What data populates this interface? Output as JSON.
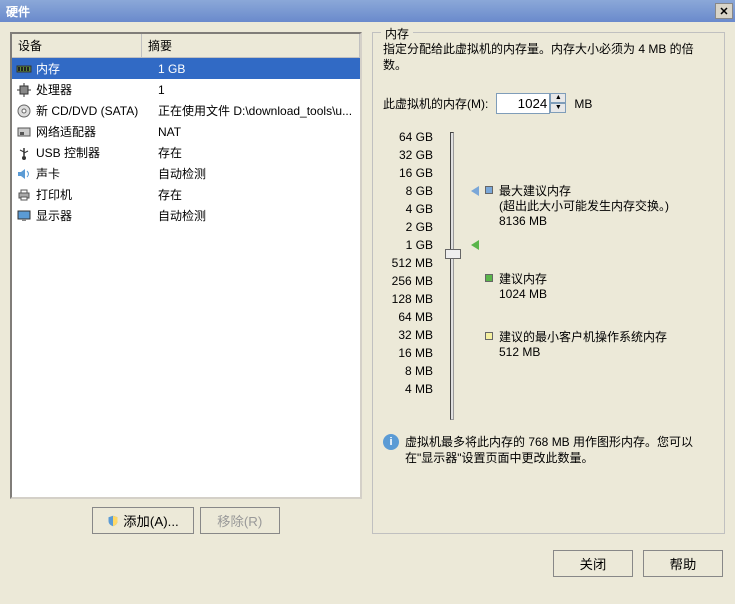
{
  "title": "硬件",
  "columns": {
    "device": "设备",
    "summary": "摘要"
  },
  "devices": [
    {
      "name": "内存",
      "summary": "1 GB",
      "selected": true
    },
    {
      "name": "处理器",
      "summary": "1"
    },
    {
      "name": "新 CD/DVD (SATA)",
      "summary": "正在使用文件 D:\\download_tools\\u..."
    },
    {
      "name": "网络适配器",
      "summary": "NAT"
    },
    {
      "name": "USB 控制器",
      "summary": "存在"
    },
    {
      "name": "声卡",
      "summary": "自动检测"
    },
    {
      "name": "打印机",
      "summary": "存在"
    },
    {
      "name": "显示器",
      "summary": "自动检测"
    }
  ],
  "buttons": {
    "add": "添加(A)...",
    "remove": "移除(R)",
    "close": "关闭",
    "help": "帮助"
  },
  "memory": {
    "group_title": "内存",
    "desc": "指定分配给此虚拟机的内存量。内存大小必须为 4 MB 的倍数。",
    "input_label": "此虚拟机的内存(M):",
    "value": "1024",
    "unit": "MB",
    "scale": [
      "64 GB",
      "32 GB",
      "16 GB",
      "8 GB",
      "4 GB",
      "2 GB",
      "1 GB",
      "512 MB",
      "256 MB",
      "128 MB",
      "64 MB",
      "32 MB",
      "16 MB",
      "8 MB",
      "4 MB"
    ],
    "markers": {
      "max": {
        "title": "最大建议内存",
        "note": "(超出此大小可能发生内存交换。)",
        "value": "8136 MB"
      },
      "rec": {
        "title": "建议内存",
        "value": "1024 MB"
      },
      "min": {
        "title": "建议的最小客户机操作系统内存",
        "value": "512 MB"
      }
    },
    "info": "虚拟机最多将此内存的 768 MB 用作图形内存。您可以在\"显示器\"设置页面中更改此数量。"
  }
}
